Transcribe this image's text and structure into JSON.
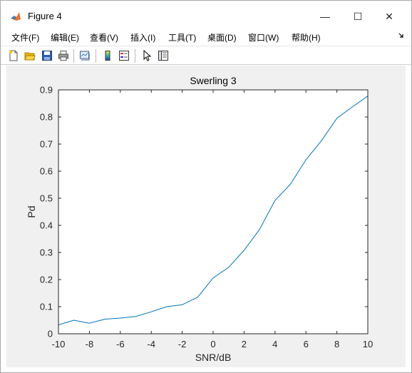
{
  "window": {
    "title": "Figure 4",
    "controls": {
      "minimize": "—",
      "maximize": "☐",
      "close": "✕"
    }
  },
  "menubar": {
    "items": [
      {
        "label": "文件(F)"
      },
      {
        "label": "编辑(E)"
      },
      {
        "label": "查看(V)"
      },
      {
        "label": "插入(I)"
      },
      {
        "label": "工具(T)"
      },
      {
        "label": "桌面(D)"
      },
      {
        "label": "窗口(W)"
      },
      {
        "label": "帮助(H)"
      }
    ],
    "overflow_icon": "arrow-dock-icon"
  },
  "toolbar": {
    "buttons": [
      {
        "icon": "new-figure-icon"
      },
      {
        "icon": "open-file-icon"
      },
      {
        "icon": "save-icon"
      },
      {
        "icon": "print-icon"
      },
      {
        "icon": "link-plot-icon"
      },
      {
        "icon": "colorbar-icon"
      },
      {
        "icon": "legend-icon"
      },
      {
        "icon": "pointer-icon"
      },
      {
        "icon": "property-inspector-icon"
      }
    ]
  },
  "chart_data": {
    "type": "line",
    "title": "Swerling 3",
    "xlabel": "SNR/dB",
    "ylabel": "Pd",
    "xlim": [
      -10,
      10
    ],
    "ylim": [
      0,
      0.9
    ],
    "xticks": [
      "-10",
      "-8",
      "-6",
      "-4",
      "-2",
      "0",
      "2",
      "4",
      "6",
      "8",
      "10"
    ],
    "yticks": [
      "0",
      "0.1",
      "0.2",
      "0.3",
      "0.4",
      "0.5",
      "0.6",
      "0.7",
      "0.8",
      "0.9"
    ],
    "grid": false,
    "series": [
      {
        "color": "#0072bd",
        "x": [
          -10,
          -9,
          -8,
          -7,
          -6,
          -5,
          -4,
          -3,
          -2,
          -1,
          0,
          1,
          2,
          3,
          4,
          5,
          6,
          7,
          8,
          9,
          10
        ],
        "y": [
          0.033,
          0.05,
          0.039,
          0.054,
          0.058,
          0.064,
          0.081,
          0.1,
          0.107,
          0.135,
          0.206,
          0.245,
          0.308,
          0.385,
          0.492,
          0.552,
          0.642,
          0.712,
          0.795,
          0.837,
          0.877
        ]
      }
    ]
  }
}
